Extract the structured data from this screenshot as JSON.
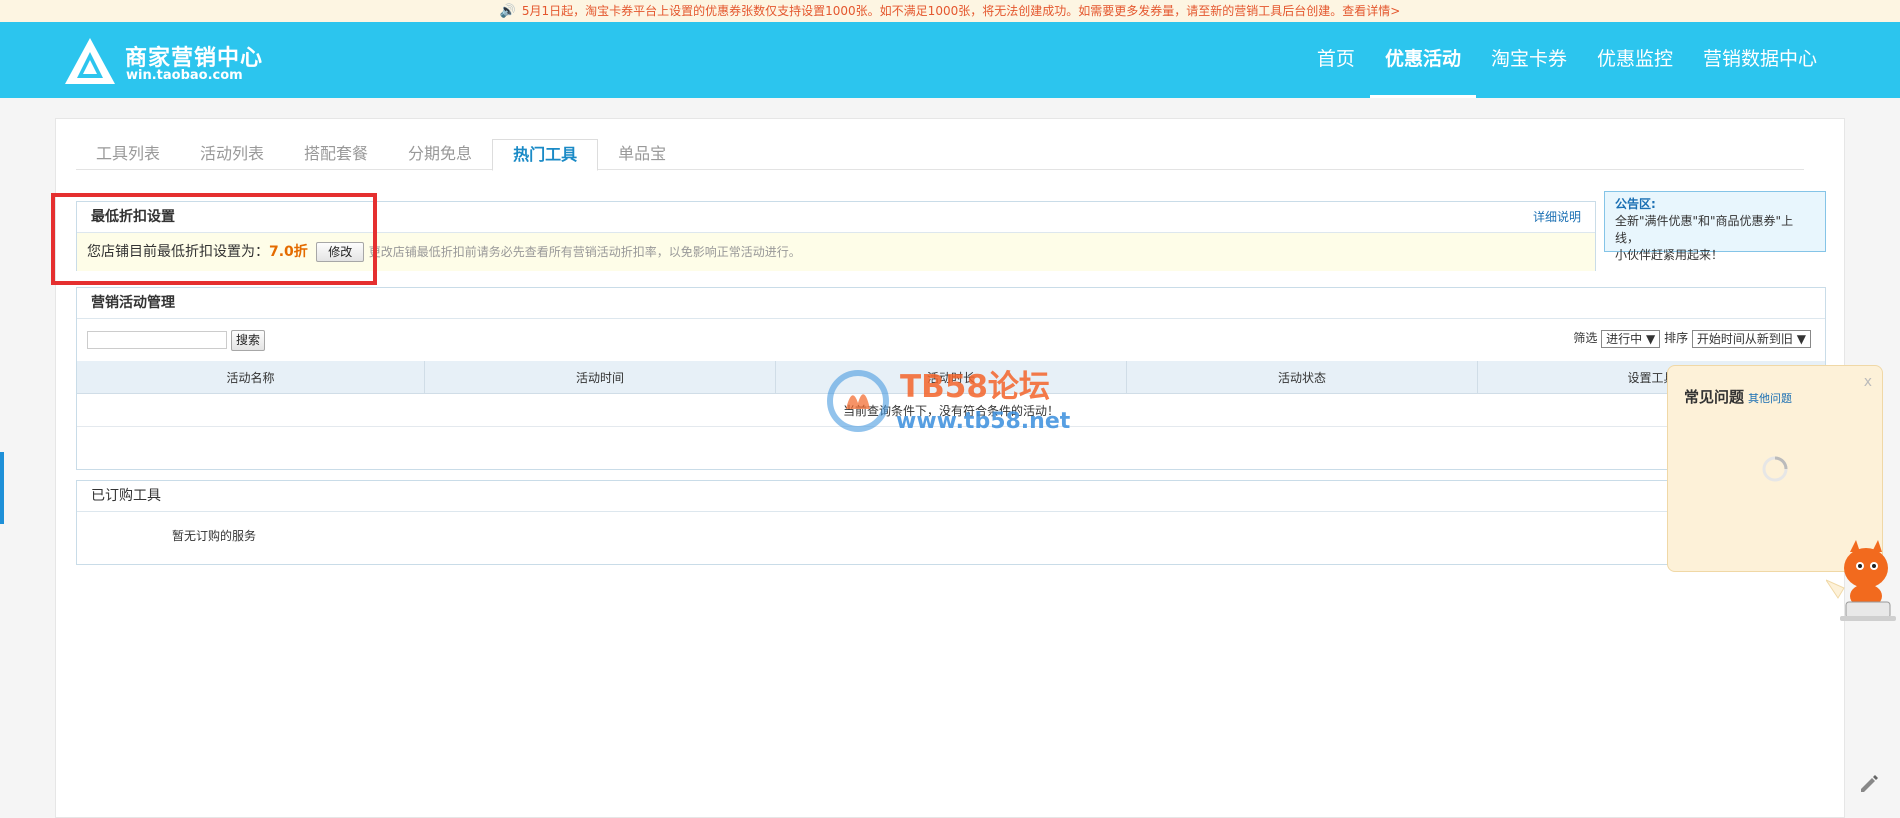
{
  "notice": {
    "text": "5月1日起，淘宝卡券平台上设置的优惠券张数仅支持设置1000张。如不满足1000张，将无法创建成功。如需要更多发券量，请至新的营销工具后台创建。查看详情>",
    "icon": "speaker-icon"
  },
  "header": {
    "logo_title": "商家营销中心",
    "logo_sub": "win.taobao.com",
    "brand_color": "#2cc5ee",
    "nav": [
      {
        "label": "首页",
        "active": false
      },
      {
        "label": "优惠活动",
        "active": true
      },
      {
        "label": "淘宝卡券",
        "active": false
      },
      {
        "label": "优惠监控",
        "active": false
      },
      {
        "label": "营销数据中心",
        "active": false
      }
    ]
  },
  "tabs": [
    {
      "label": "工具列表",
      "active": false
    },
    {
      "label": "活动列表",
      "active": false
    },
    {
      "label": "搭配套餐",
      "active": false
    },
    {
      "label": "分期免息",
      "active": false
    },
    {
      "label": "热门工具",
      "active": true
    },
    {
      "label": "单品宝",
      "active": false
    }
  ],
  "min_discount": {
    "title": "最低折扣设置",
    "detail_link": "详细说明",
    "prefix": "您店铺目前最低折扣设置为：",
    "value": "7.0折",
    "modify_button": "修改",
    "hint": "更改店铺最低折扣前请务必先查看所有营销活动折扣率，以免影响正常活动进行。"
  },
  "bulletin": {
    "title": "公告区:",
    "line1": "全新\"满件优惠\"和\"商品优惠券\"上线，",
    "line2": "小伙伴赶紧用起来！"
  },
  "activity_mgmt": {
    "title": "营销活动管理",
    "search_button": "搜索",
    "search_value": "",
    "filter_label": "筛选",
    "filter_value": "进行中",
    "sort_label": "排序",
    "sort_value": "开始时间从新到旧",
    "columns": [
      "活动名称",
      "活动时间",
      "活动时长",
      "活动状态",
      "设置工具"
    ],
    "empty_message": "当前查询条件下，没有符合条件的活动！"
  },
  "subscribed": {
    "title": "已订购工具",
    "empty_message": "暂无订购的服务"
  },
  "watermark": {
    "title": "TB58论坛",
    "url": "www.tb58.net"
  },
  "faq": {
    "title": "常见问题",
    "more": "其他问题",
    "close": "x"
  }
}
